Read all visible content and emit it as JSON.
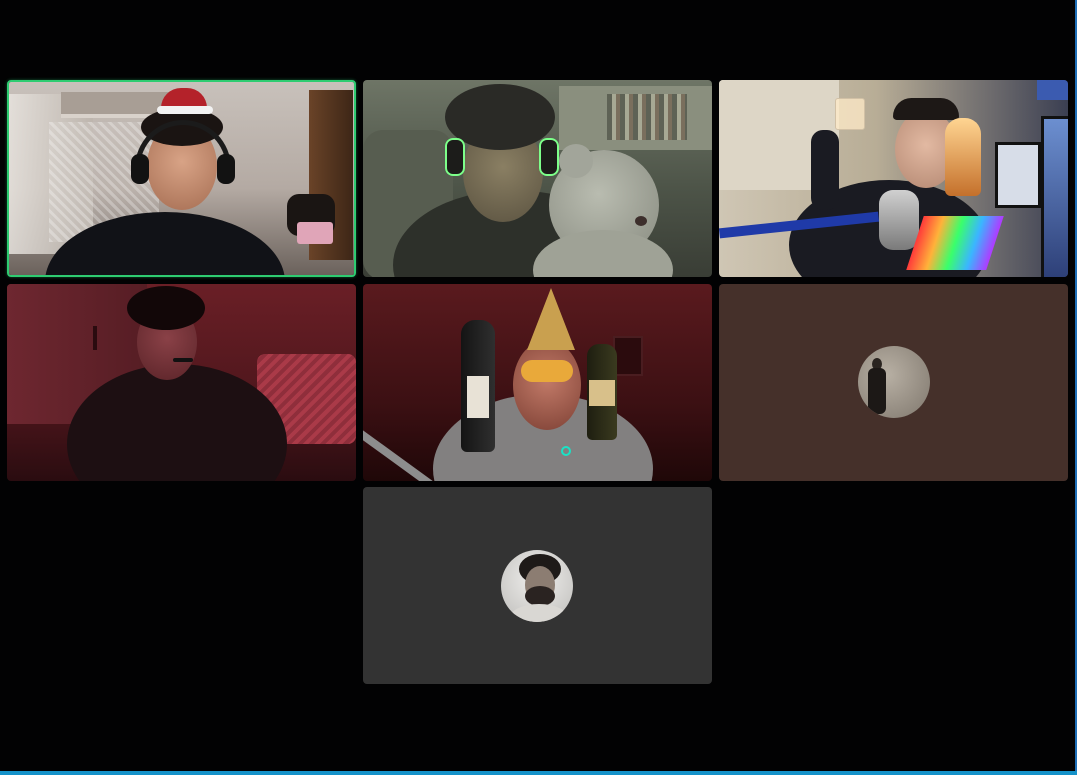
{
  "meeting": {
    "view": "gallery"
  },
  "colors": {
    "background": "#020203",
    "active_speaker_border": "#2ecc71",
    "tile_brown": "#45302a",
    "tile_gray": "#333333",
    "edge_blue": "#1592c9"
  },
  "participants": [
    {
      "kind": "video",
      "scene": "santa-hat-headset",
      "active_speaker": true
    },
    {
      "kind": "video",
      "scene": "headset-teddy-bear",
      "active_speaker": false
    },
    {
      "kind": "video",
      "scene": "toast-whisky-setup",
      "active_speaker": false
    },
    {
      "kind": "video",
      "scene": "red-room-headset",
      "active_speaker": false
    },
    {
      "kind": "video",
      "scene": "party-hat-bottles",
      "active_speaker": false
    },
    {
      "kind": "avatar",
      "scene": "profile-picture",
      "active_speaker": false
    },
    {
      "kind": "avatar",
      "scene": "profile-picture",
      "active_speaker": false
    }
  ]
}
